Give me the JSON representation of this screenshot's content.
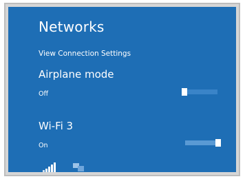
{
  "panel": {
    "title": "Networks",
    "view_settings_link": "View Connection Settings"
  },
  "airplane": {
    "title": "Airplane mode",
    "state": "Off",
    "enabled": false
  },
  "wifi": {
    "title": "Wi-Fi 3",
    "state": "On",
    "enabled": true
  },
  "status_icons": [
    "signal-strength-icon",
    "network-icon"
  ],
  "colors": {
    "panel_bg": "#1e6eb5",
    "text": "#ffffff",
    "toggle_track": "#3a84c8"
  }
}
